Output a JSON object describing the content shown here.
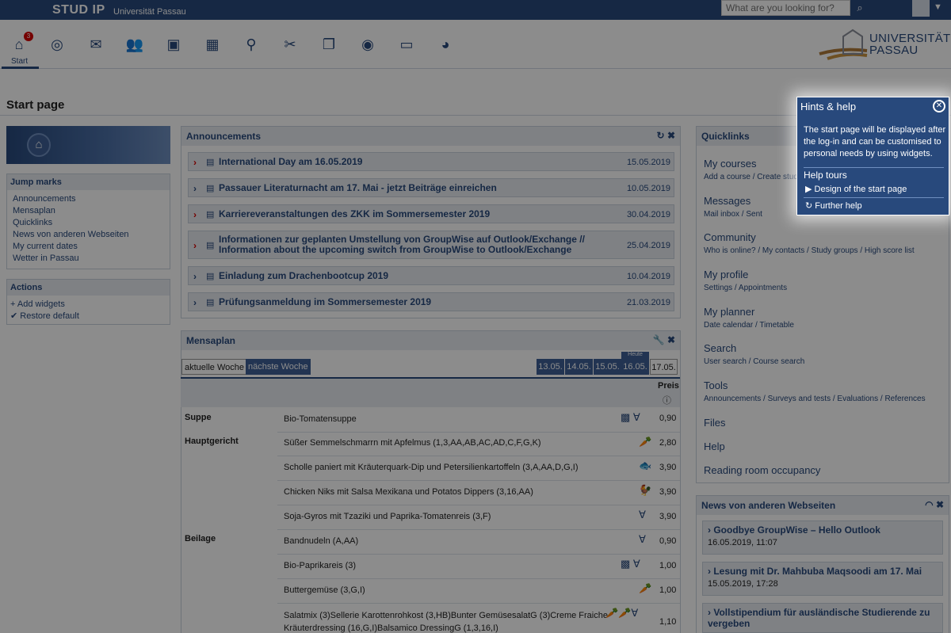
{
  "topbar": {
    "brand": "STUD IP",
    "university": "Universität Passau",
    "search_placeholder": "What are you looking for?"
  },
  "nav": {
    "home_label": "Start",
    "home_badge": "3",
    "logo_text_line1": "UNIVERSITÄT",
    "logo_text_line2": "PASSAU"
  },
  "page": {
    "title": "Start page"
  },
  "sidebar": {
    "jump_marks": {
      "title": "Jump marks",
      "items": [
        "Announcements",
        "Mensaplan",
        "Quicklinks",
        "News von anderen Webseiten",
        "My current dates",
        "Wetter in Passau"
      ]
    },
    "actions": {
      "title": "Actions",
      "items": [
        {
          "icon": "+",
          "label": "Add widgets"
        },
        {
          "icon": "✔",
          "label": "Restore default"
        }
      ]
    }
  },
  "announcements": {
    "title": "Announcements",
    "items": [
      {
        "title": "International Day am 16.05.2019",
        "date": "15.05.2019"
      },
      {
        "title": "Passauer Literaturnacht am 17. Mai - jetzt Beiträge einreichen",
        "date": "10.05.2019"
      },
      {
        "title": "Karriereveranstaltungen des ZKK im Sommersemester 2019",
        "date": "30.04.2019"
      },
      {
        "title": "Informationen zur geplanten Umstellung von GroupWise auf Outlook/Exchange // Information about the upcoming switch from GroupWise to Outlook/Exchange",
        "date": "25.04.2019"
      },
      {
        "title": "Einladung zum Drachenbootcup 2019",
        "date": "10.04.2019"
      },
      {
        "title": "Prüfungsanmeldung im Sommersemester 2019",
        "date": "21.03.2019"
      }
    ]
  },
  "mensaplan": {
    "title": "Mensaplan",
    "tab_current": "aktuelle Woche",
    "tab_next": "nächste Woche",
    "heute": "Heute",
    "days": [
      "13.05.",
      "14.05.",
      "15.05.",
      "16.05.",
      "17.05."
    ],
    "price_header": "Preis",
    "price_info_icon": "ⓘ",
    "categories": [
      "Suppe",
      "Hauptgericht",
      "Beilage"
    ],
    "dishes": [
      {
        "name": "Bio-Tomatensuppe",
        "icon": "vegan-icon",
        "price": "0,90"
      },
      {
        "name": "Süßer Semmelschmarrn mit Apfelmus (1,3,AA,AB,AC,AD,C,F,G,K)",
        "icon": "vegetarian-icon",
        "price": "2,80"
      },
      {
        "name": "Scholle paniert mit Kräuterquark-Dip und Petersilienkartoffeln (3,A,AA,D,G,I)",
        "icon": "fish-icon",
        "price": "3,90"
      },
      {
        "name": "Chicken Niks mit Salsa Mexikana und Potatos Dippers (3,16,AA)",
        "icon": "poultry-icon",
        "price": "3,90"
      },
      {
        "name": "Soja-Gyros mit Tzaziki und Paprika-Tomatenreis (3,F)",
        "icon": "vegan-icon",
        "price": "3,90"
      },
      {
        "name": "Bandnudeln (A,AA)",
        "icon": "vegan-icon",
        "price": "0,90"
      },
      {
        "name": "Bio-Paprikareis (3)",
        "icon": "vegan-icon",
        "price": "1,00"
      },
      {
        "name": "Buttergemüse (3,G,I)",
        "icon": "vegetarian-icon",
        "price": "1,00"
      },
      {
        "name": "Salatmix (3)Sellerie Karottenrohkost (3,HB)Bunter GemüsesalatG (3)Creme Fraiche Kräuterdressing (16,G,I)Balsamico DressingG (1,3,16,I)",
        "icon": "vegetarian-icon",
        "price": "1,10"
      }
    ]
  },
  "quicklinks": {
    "title": "Quicklinks",
    "items": [
      {
        "title": "My courses",
        "sub": "Add a course / Create stud"
      },
      {
        "title": "Messages",
        "sub": "Mail inbox / Sent"
      },
      {
        "title": "Community",
        "sub": "Who is online? / My contacts / Study groups / High score list"
      },
      {
        "title": "My profile",
        "sub": "Settings / Appointments"
      },
      {
        "title": "My planner",
        "sub": "Date calendar / Timetable"
      },
      {
        "title": "Search",
        "sub": "User search / Course search"
      },
      {
        "title": "Tools",
        "sub": "Announcements / Surveys and tests / Evaluations / References"
      },
      {
        "title": "Files",
        "sub": ""
      },
      {
        "title": "Help",
        "sub": ""
      },
      {
        "title": "Reading room occupancy",
        "sub": ""
      }
    ]
  },
  "news": {
    "title": "News von anderen Webseiten",
    "items": [
      {
        "title": "Goodbye GroupWise – Hello Outlook",
        "date": "16.05.2019, 11:07"
      },
      {
        "title": "Lesung mit Dr. Mahbuba Maqsoodi am 17. Mai",
        "date": "15.05.2019, 17:28"
      },
      {
        "title": "Vollstipendium für ausländische Studierende zu vergeben",
        "date": ""
      }
    ]
  },
  "help": {
    "title": "Hints & help",
    "text": "The start page will be displayed after the log-in and can be customised to personal needs by using widgets.",
    "tours_title": "Help tours",
    "tour_link": "Design of the start page",
    "further": "Further help"
  },
  "colors": {
    "primary": "#28497c",
    "header_bg": "#e7ebf1",
    "alert": "#d60000"
  }
}
